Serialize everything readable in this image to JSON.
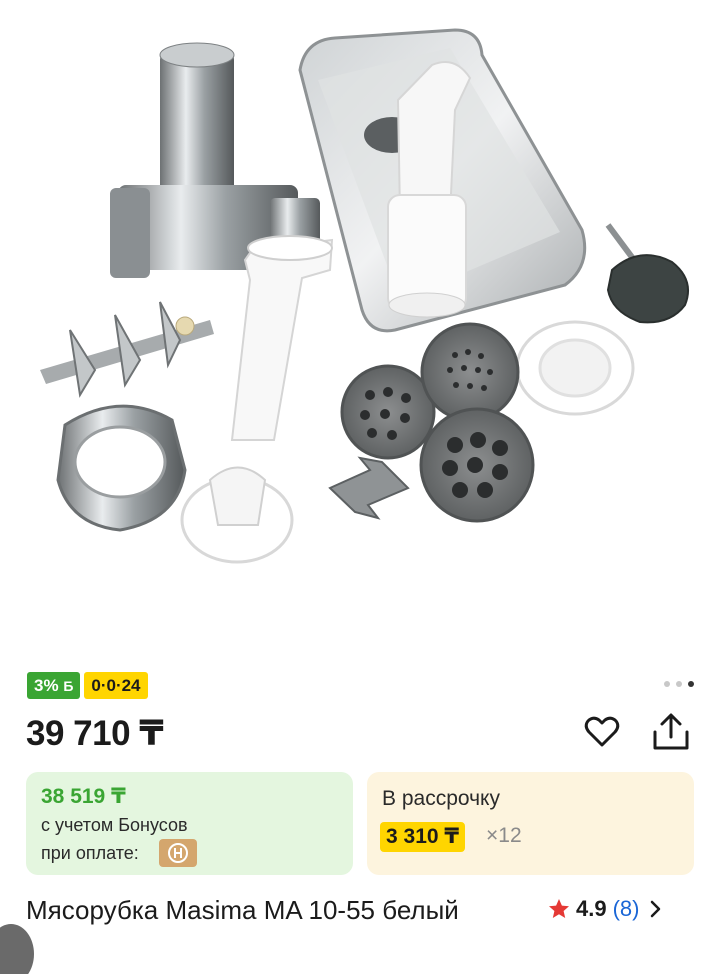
{
  "gallery": {
    "image_alt": "Мясорубка Masima MA 10-55 белый",
    "dots_count": 3,
    "active_dot": 2
  },
  "badges": {
    "bonus": "3%",
    "bonus_suffix": "Б",
    "installment": "0·0·24"
  },
  "price": "39 710 ₸",
  "bonus_card": {
    "price": "38 519 ₸",
    "line1": "с учетом Бонусов",
    "line2": "при оплате:"
  },
  "installment_card": {
    "title": "В рассрочку",
    "monthly": "3 310 ₸",
    "times": "×12"
  },
  "product": {
    "title": "Мясорубка Masima MA 10-55 белый",
    "rating": "4.9",
    "reviews": "(8)"
  },
  "colors": {
    "accent_green": "#3aa533",
    "accent_yellow": "#ffd500",
    "link_blue": "#1a66d6",
    "star_red": "#e53935"
  },
  "icons": {
    "favorite": "heart-icon",
    "share": "share-icon",
    "rating": "star-icon",
    "more": "chevron-right-icon",
    "payment": "payment-service-icon"
  }
}
